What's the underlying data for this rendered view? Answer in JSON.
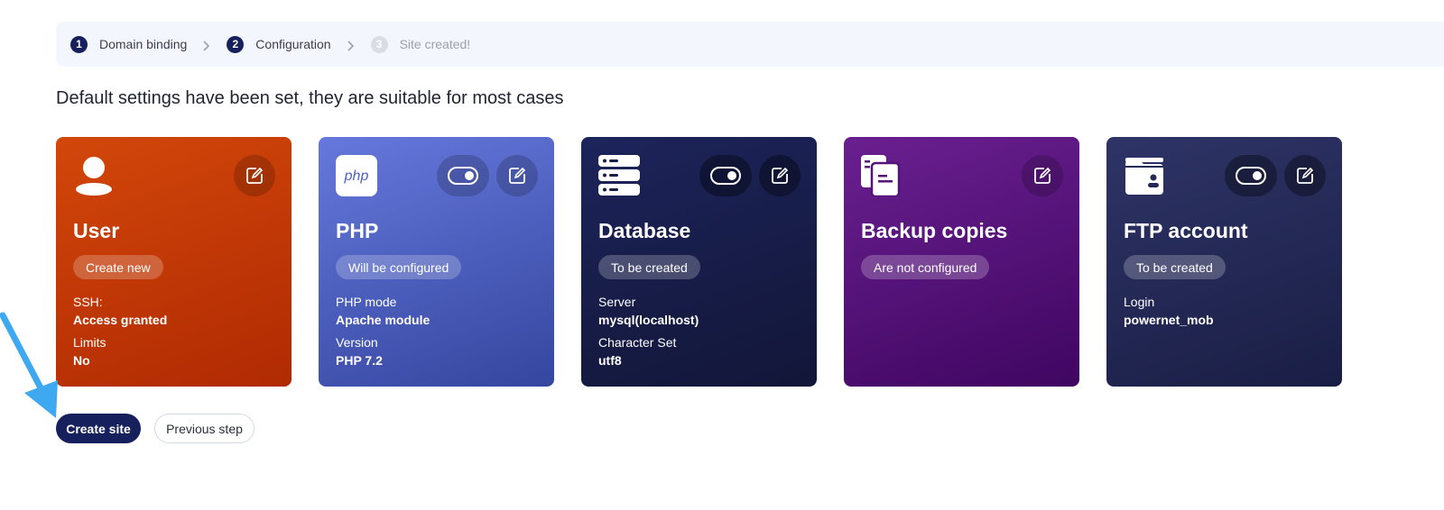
{
  "stepper": {
    "steps": [
      {
        "num": "1",
        "label": "Domain binding"
      },
      {
        "num": "2",
        "label": "Configuration"
      },
      {
        "num": "3",
        "label": "Site created!"
      }
    ]
  },
  "subtitle": "Default settings have been set, they are suitable for most cases",
  "cards": {
    "user": {
      "icon": "user-icon",
      "title": "User",
      "badge": "Create new",
      "fields": [
        {
          "label": "SSH:",
          "value": "Access granted"
        },
        {
          "label": "Limits",
          "value": "No"
        }
      ]
    },
    "php": {
      "icon": "php-icon",
      "icon_text": "php",
      "title": "PHP",
      "badge": "Will be configured",
      "fields": [
        {
          "label": "PHP mode",
          "value": "Apache module"
        },
        {
          "label": "Version",
          "value": "PHP 7.2"
        }
      ]
    },
    "database": {
      "icon": "database-icon",
      "title": "Database",
      "badge": "To be created",
      "fields": [
        {
          "label": "Server",
          "value": "mysql(localhost)"
        },
        {
          "label": "Character Set",
          "value": "utf8"
        }
      ]
    },
    "backup": {
      "icon": "backup-icon",
      "title": "Backup copies",
      "badge": "Are not configured"
    },
    "ftp": {
      "icon": "ftp-folder-icon",
      "title": "FTP account",
      "badge": "To be created",
      "fields": [
        {
          "label": "Login",
          "value": "powernet_mob"
        }
      ]
    }
  },
  "buttons": {
    "create": "Create site",
    "previous": "Previous step"
  },
  "colors": {
    "primary": "#16205c",
    "user_card": "#c23a06",
    "php_card": "#4d5fc4",
    "db_card": "#171c48",
    "backup_card": "#55127a",
    "ftp_card": "#242a56",
    "annotation_arrow": "#3ea8f0"
  }
}
